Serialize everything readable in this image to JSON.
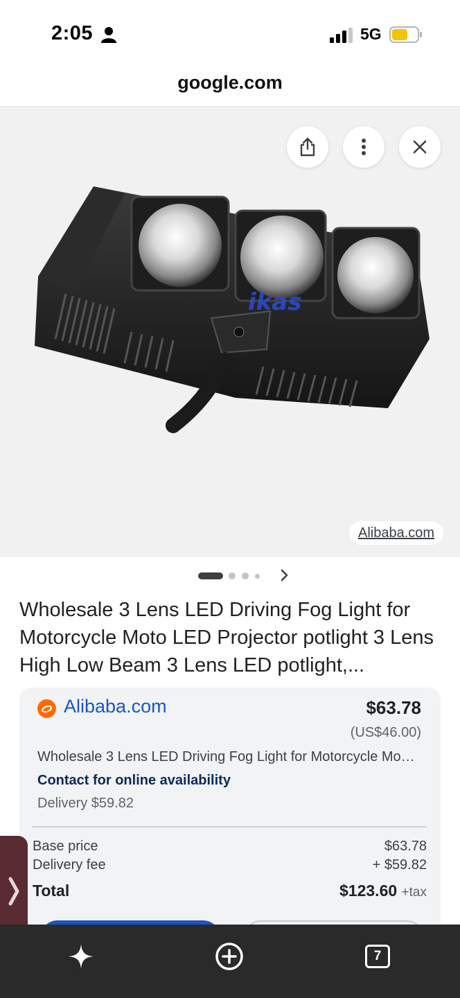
{
  "status_bar": {
    "time": "2:05",
    "network": "5G",
    "icons": [
      "person-icon",
      "signal-icon",
      "battery-icon"
    ],
    "battery_color": "#f5c400"
  },
  "browser": {
    "url": "google.com"
  },
  "image_viewer": {
    "image_subject": "product-image",
    "source_chip": "Alibaba.com",
    "actions": [
      "share-icon",
      "more-icon",
      "close-icon"
    ],
    "carousel": {
      "total_dots": 4,
      "active_index": 0
    }
  },
  "product": {
    "title": "Wholesale 3 Lens LED Driving Fog Light for Motorcycle Moto LED Projector potlight 3 Lens High Low Beam 3 Lens LED potlight,..."
  },
  "offer": {
    "merchant": "Alibaba.com",
    "price": "$63.78",
    "price_usd": "(US$46.00)",
    "description": "Wholesale 3 Lens LED Driving Fog Light for Motorcycle Mo…",
    "availability": "Contact for online availability",
    "delivery": "Delivery $59.82",
    "breakdown": [
      {
        "label": "Base price",
        "value": "$63.78"
      },
      {
        "label": "Delivery fee",
        "value": "+ $59.82"
      }
    ],
    "total_label": "Total",
    "total_value": "$123.60",
    "total_suffix": "+tax",
    "colors": {
      "merchant_link": "#1a56c4",
      "primary_button": "#1a56c4",
      "merchant_logo": "#ff6a00"
    }
  },
  "toolbar": {
    "icons": [
      "sparkle-icon",
      "add-tab-icon",
      "tabs-icon"
    ],
    "tab_count": "7"
  }
}
